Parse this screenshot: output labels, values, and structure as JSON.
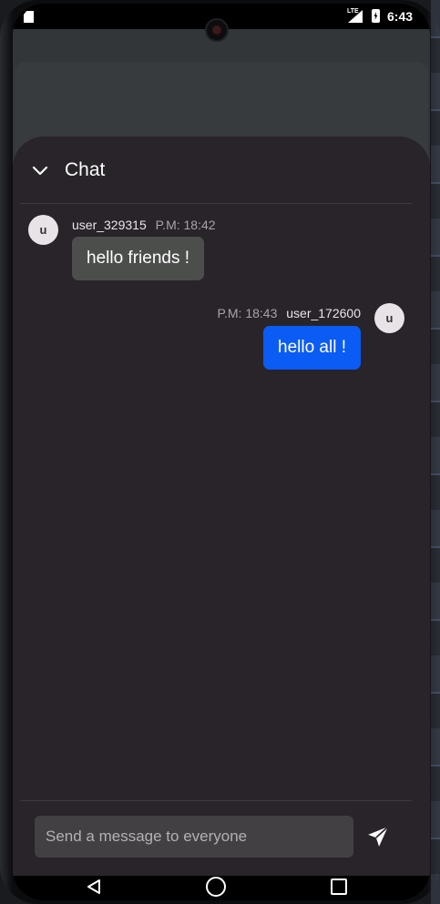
{
  "status_bar": {
    "network_label": "LTE",
    "time": "6:43",
    "icons": [
      "sd-card-icon",
      "lte-signal-icon",
      "battery-charging-icon"
    ]
  },
  "chat": {
    "title": "Chat",
    "collapse_icon": "chevron-down-icon",
    "messages": [
      {
        "avatar_letter": "u",
        "user": "user_329315",
        "time": "P.M: 18:42",
        "text": "hello friends !",
        "side": "left",
        "bubble_color": "#4c4e4c"
      },
      {
        "avatar_letter": "u",
        "user": "user_172600",
        "time": "P.M: 18:43",
        "text": "hello all !",
        "side": "right",
        "bubble_color": "#0a5cf4"
      }
    ],
    "composer": {
      "placeholder": "Send a message to everyone",
      "value": "",
      "send_icon": "send-icon"
    }
  },
  "nav_bar": {
    "icons": [
      "back-icon",
      "home-icon",
      "recents-icon"
    ]
  },
  "colors": {
    "sheet_background": "#282429",
    "app_background": "#333638",
    "accent": "#0a5cf4"
  }
}
